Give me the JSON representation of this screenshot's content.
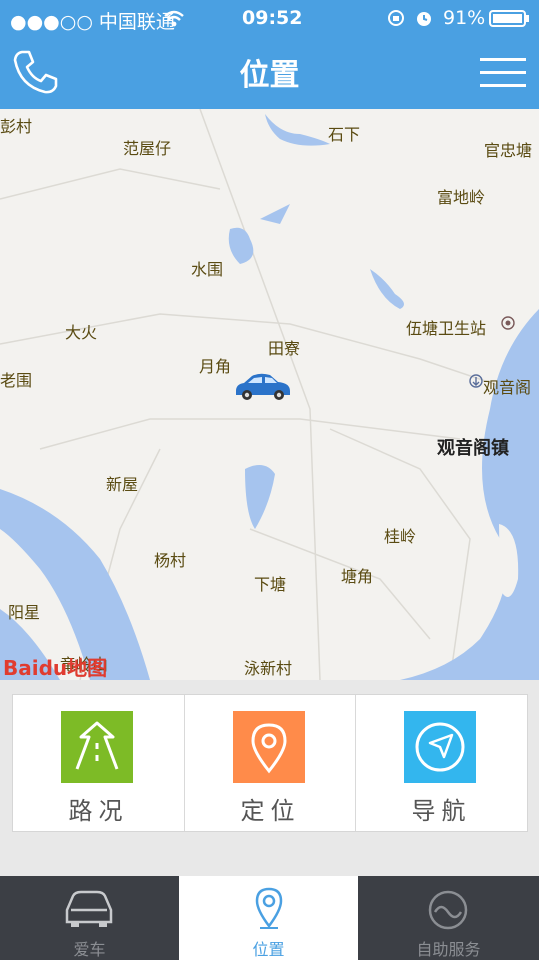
{
  "status_bar": {
    "carrier": "●●●○○ 中国联通",
    "time": "09:52",
    "battery": "91%"
  },
  "header": {
    "title": "位置"
  },
  "map": {
    "provider": "Baidu地图",
    "labels": [
      {
        "text": "彭村",
        "cls": ""
      },
      {
        "text": "范屋仔",
        "cls": ""
      },
      {
        "text": "石下",
        "cls": ""
      },
      {
        "text": "官忠塘",
        "cls": ""
      },
      {
        "text": "富地岭",
        "cls": ""
      },
      {
        "text": "水围",
        "cls": ""
      },
      {
        "text": "大火",
        "cls": ""
      },
      {
        "text": "田寮",
        "cls": ""
      },
      {
        "text": "月角",
        "cls": ""
      },
      {
        "text": "老围",
        "cls": ""
      },
      {
        "text": "伍塘卫生站",
        "cls": ""
      },
      {
        "text": "观音阁",
        "cls": ""
      },
      {
        "text": "观音阁镇",
        "cls": "big"
      },
      {
        "text": "新屋",
        "cls": ""
      },
      {
        "text": "桂岭",
        "cls": ""
      },
      {
        "text": "杨村",
        "cls": ""
      },
      {
        "text": "下塘",
        "cls": ""
      },
      {
        "text": "塘角",
        "cls": ""
      },
      {
        "text": "阳星",
        "cls": ""
      },
      {
        "text": "竜岭山",
        "cls": ""
      },
      {
        "text": "泳新村",
        "cls": ""
      }
    ]
  },
  "actions": [
    {
      "label": "路况"
    },
    {
      "label": "定位"
    },
    {
      "label": "导航"
    }
  ],
  "colors": {
    "header": "#4aa0e2",
    "traffic": "#7dbb26",
    "locate": "#ff8b4a",
    "navigate": "#33b6ee",
    "tabbar": "#3c3f45"
  },
  "tabs": [
    {
      "label": "爱车"
    },
    {
      "label": "位置"
    },
    {
      "label": "自助服务"
    }
  ]
}
